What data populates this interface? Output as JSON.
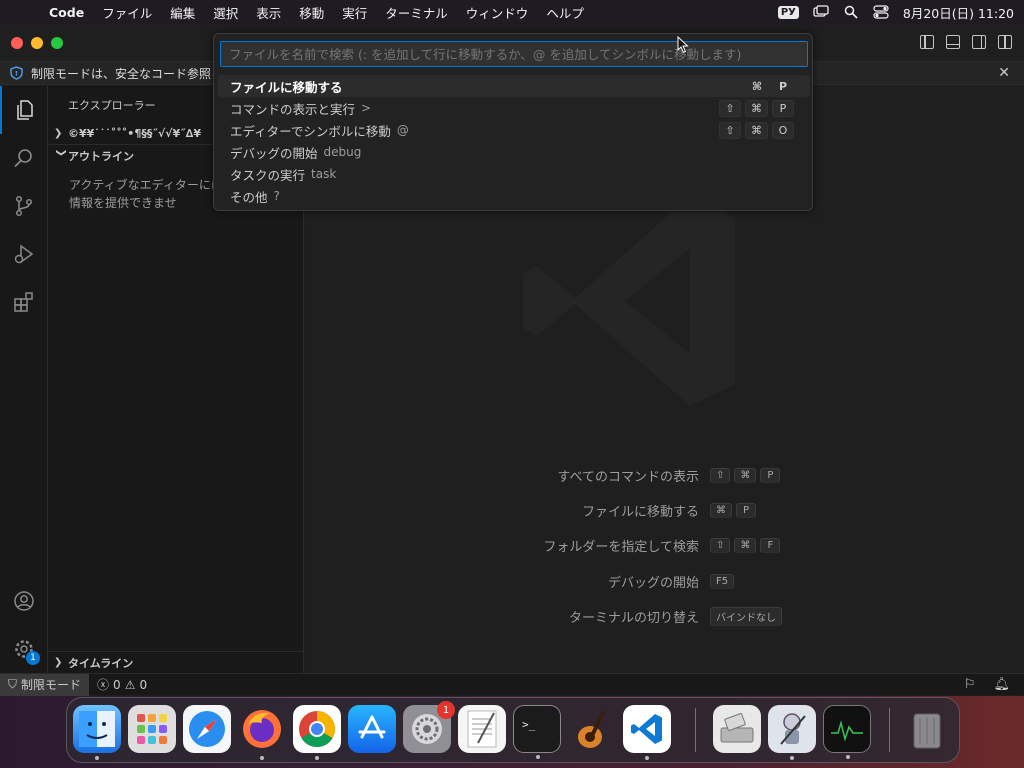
{
  "menubar": {
    "app": "Code",
    "items": [
      "ファイル",
      "編集",
      "選択",
      "表示",
      "移動",
      "実行",
      "ターミナル",
      "ウィンドウ",
      "ヘルプ"
    ],
    "input_source": "РУ",
    "date_time": "8月20日(日) 11:20"
  },
  "banner": {
    "text": "制限モードは、安全なコード参照"
  },
  "sidebar": {
    "title": "エクスプローラー",
    "folder": "©¥¥˙˙˙˚˚˚•¶§§˝√√¥˝∆¥",
    "outline_title": "アウトライン",
    "outline_empty": "アクティブなエディターにはアウトライン情報を提供できませ",
    "timeline_title": "タイムライン"
  },
  "palette": {
    "placeholder": "ファイルを名前で検索 (: を追加して行に移動するか、@ を追加してシンボルに移動します)",
    "rows": [
      {
        "label": "ファイルに移動する",
        "hint": "",
        "keys": [
          "⌘",
          "P"
        ]
      },
      {
        "label": "コマンドの表示と実行",
        "hint": ">",
        "keys": [
          "⇧",
          "⌘",
          "P"
        ]
      },
      {
        "label": "エディターでシンボルに移動",
        "hint": "@",
        "keys": [
          "⇧",
          "⌘",
          "O"
        ]
      },
      {
        "label": "デバッグの開始",
        "hint": "debug",
        "keys": []
      },
      {
        "label": "タスクの実行",
        "hint": "task",
        "keys": []
      },
      {
        "label": "その他",
        "hint": "?",
        "keys": []
      }
    ]
  },
  "shortcuts": [
    {
      "label": "すべてのコマンドの表示",
      "keys": [
        "⇧",
        "⌘",
        "P"
      ]
    },
    {
      "label": "ファイルに移動する",
      "keys": [
        "⌘",
        "P"
      ]
    },
    {
      "label": "フォルダーを指定して検索",
      "keys": [
        "⇧",
        "⌘",
        "F"
      ]
    },
    {
      "label": "デバッグの開始",
      "keys": [
        "F5"
      ]
    },
    {
      "label": "ターミナルの切り替え",
      "keys": [
        "バインドなし"
      ]
    }
  ],
  "statusbar": {
    "restricted": "制限モード",
    "errors": "0",
    "warnings": "0"
  },
  "activity_badge": "1",
  "dock": {
    "settings_badge": "1"
  },
  "colors": {
    "accent": "#0078d4",
    "selected_row": "#2c2c2c",
    "status_restricted_bg": "#3a3a3a"
  }
}
